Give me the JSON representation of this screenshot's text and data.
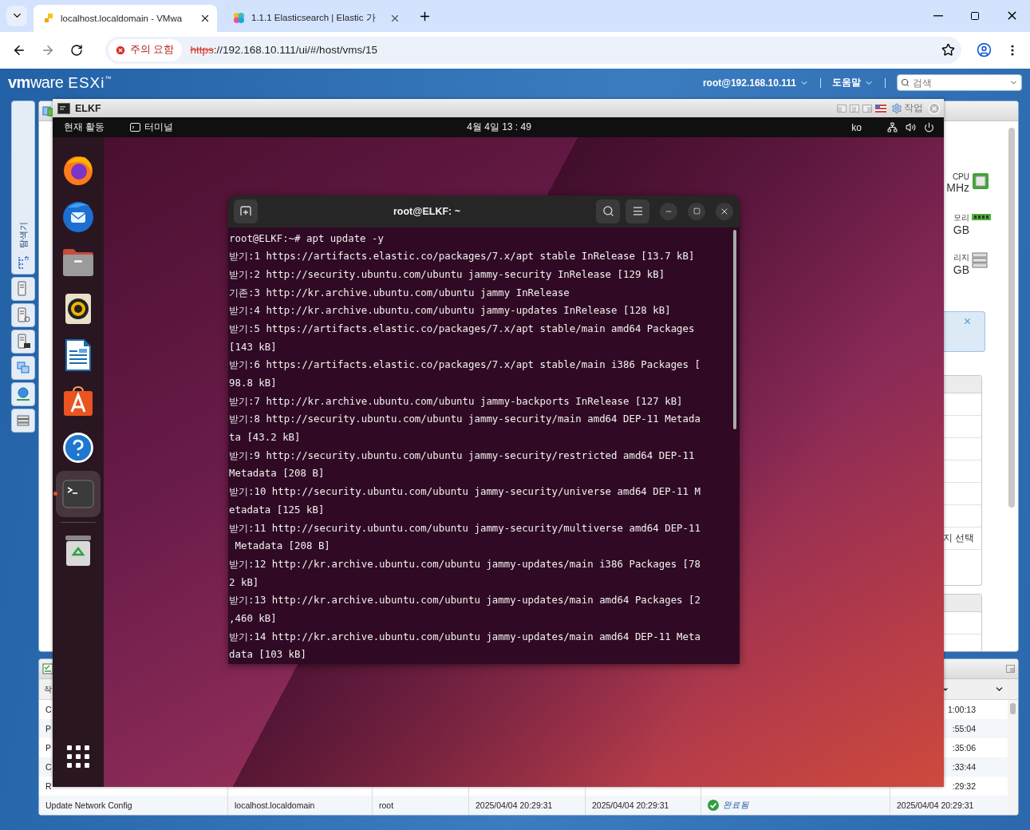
{
  "browser": {
    "tabs": [
      {
        "title": "localhost.localdomain - VMwa",
        "selected": true
      },
      {
        "title": "1.1.1 Elasticsearch | Elastic 가",
        "selected": false
      }
    ],
    "security_label": "주의 요함",
    "url_scheme": "https",
    "url_rest": "://192.168.10.111/ui/#/host/vms/15"
  },
  "esxi_header": {
    "logo_vm": "vm",
    "logo_ware": "ware",
    "product": "ESXi",
    "trademark": "™",
    "user": "root@192.168.10.111",
    "help": "도움말",
    "search_placeholder": "검색"
  },
  "navigator": {
    "label": "탐색기"
  },
  "host_summary": [
    {
      "label": "CPU",
      "value": "MHz",
      "kind": "cpu"
    },
    {
      "label": "모리",
      "value": "GB",
      "kind": "memory"
    },
    {
      "label": "리지",
      "value": "GB",
      "kind": "storage"
    }
  ],
  "selection_hint": "지 선택",
  "tasks": {
    "header_fragment": "작",
    "rows": [
      {
        "kind": "partial",
        "first": "C",
        "last": "1:00:13"
      },
      {
        "kind": "partial",
        "first": "P",
        "last": ":55:04"
      },
      {
        "kind": "partial",
        "first": "P",
        "last": ":35:06"
      },
      {
        "kind": "partial",
        "first": "C",
        "last": ":33:44"
      },
      {
        "kind": "partial",
        "first": "R",
        "last": ":29:32"
      },
      {
        "kind": "full",
        "task": "Update Network Config",
        "target": "localhost.localdomain",
        "initiator": "root",
        "queued": "2025/04/04 20:29:31",
        "started": "2025/04/04 20:29:31",
        "succeeded": true,
        "result": "완료됨",
        "completed": "2025/04/04 20:29:31"
      }
    ]
  },
  "console": {
    "title": "ELKF",
    "actions": "작업",
    "topbar": {
      "activities": "현재 활동",
      "app": "터미널",
      "clock": "4월 4일 13 : 49",
      "language": "ko"
    },
    "dock": [
      {
        "kind": "firefox",
        "running": false
      },
      {
        "kind": "thunderbird",
        "running": false
      },
      {
        "kind": "files",
        "running": false
      },
      {
        "kind": "rhythmbox",
        "running": false
      },
      {
        "kind": "writer",
        "running": false
      },
      {
        "kind": "appcenter",
        "running": false
      },
      {
        "kind": "help",
        "running": false
      },
      {
        "kind": "terminal",
        "running": true
      },
      {
        "kind": "trash",
        "running": false
      }
    ],
    "terminal": {
      "title": "root@ELKF: ~",
      "lines": [
        "root@ELKF:~# apt update -y",
        "받기:1 https://artifacts.elastic.co/packages/7.x/apt stable InRelease [13.7 kB]",
        "받기:2 http://security.ubuntu.com/ubuntu jammy-security InRelease [129 kB]",
        "기존:3 http://kr.archive.ubuntu.com/ubuntu jammy InRelease",
        "받기:4 http://kr.archive.ubuntu.com/ubuntu jammy-updates InRelease [128 kB]",
        "받기:5 https://artifacts.elastic.co/packages/7.x/apt stable/main amd64 Packages",
        "[143 kB]",
        "받기:6 https://artifacts.elastic.co/packages/7.x/apt stable/main i386 Packages [",
        "98.8 kB]",
        "받기:7 http://kr.archive.ubuntu.com/ubuntu jammy-backports InRelease [127 kB]",
        "받기:8 http://security.ubuntu.com/ubuntu jammy-security/main amd64 DEP-11 Metada",
        "ta [43.2 kB]",
        "받기:9 http://security.ubuntu.com/ubuntu jammy-security/restricted amd64 DEP-11",
        "Metadata [208 B]",
        "받기:10 http://security.ubuntu.com/ubuntu jammy-security/universe amd64 DEP-11 M",
        "etadata [125 kB]",
        "받기:11 http://security.ubuntu.com/ubuntu jammy-security/multiverse amd64 DEP-11",
        " Metadata [208 B]",
        "받기:12 http://kr.archive.ubuntu.com/ubuntu jammy-updates/main i386 Packages [78",
        "2 kB]",
        "받기:13 http://kr.archive.ubuntu.com/ubuntu jammy-updates/main amd64 Packages [2",
        ",460 kB]",
        "받기:14 http://kr.archive.ubuntu.com/ubuntu jammy-updates/main amd64 DEP-11 Meta",
        "data [103 kB]"
      ]
    }
  }
}
